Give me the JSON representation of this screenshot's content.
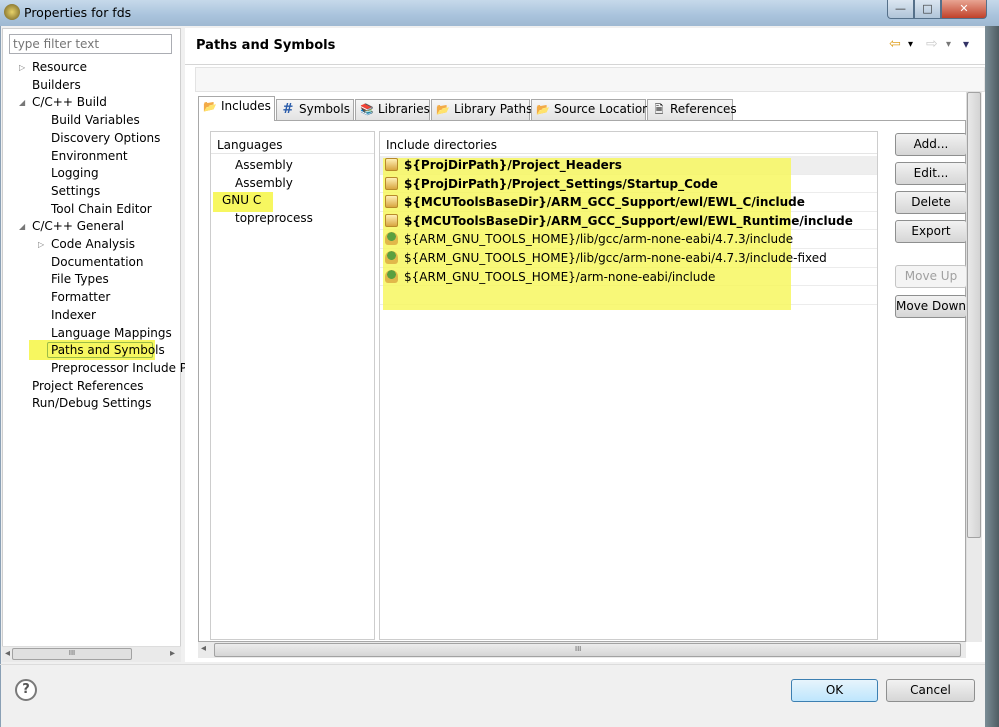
{
  "window": {
    "title": "Properties for fds",
    "minimize": "—",
    "maximize": "□",
    "close": "✕"
  },
  "filter": {
    "placeholder": "type filter text"
  },
  "tree": [
    {
      "label": "Resource",
      "level": 0,
      "twisty": "▷"
    },
    {
      "label": "Builders",
      "level": 0
    },
    {
      "label": "C/C++ Build",
      "level": 0,
      "twisty": "◢"
    },
    {
      "label": "Build Variables",
      "level": 1
    },
    {
      "label": "Discovery Options",
      "level": 1
    },
    {
      "label": "Environment",
      "level": 1
    },
    {
      "label": "Logging",
      "level": 1
    },
    {
      "label": "Settings",
      "level": 1
    },
    {
      "label": "Tool Chain Editor",
      "level": 1
    },
    {
      "label": "C/C++ General",
      "level": 0,
      "twisty": "◢"
    },
    {
      "label": "Code Analysis",
      "level": 1,
      "twisty": "▷"
    },
    {
      "label": "Documentation",
      "level": 1
    },
    {
      "label": "File Types",
      "level": 1
    },
    {
      "label": "Formatter",
      "level": 1
    },
    {
      "label": "Indexer",
      "level": 1
    },
    {
      "label": "Language Mappings",
      "level": 1
    },
    {
      "label": "Paths and Symbols",
      "level": 1,
      "selected": true
    },
    {
      "label": "Preprocessor Include Pa",
      "level": 1
    },
    {
      "label": "Project References",
      "level": 0
    },
    {
      "label": "Run/Debug Settings",
      "level": 0
    }
  ],
  "page": {
    "title": "Paths and Symbols"
  },
  "nav": {
    "back": "⇦",
    "back_menu": "▾",
    "forward": "⇨",
    "forward_menu": "▾",
    "view_menu": "▾"
  },
  "tabs": [
    {
      "label": "Includes",
      "icon": "📂",
      "active": true
    },
    {
      "label": "Symbols",
      "icon": "#"
    },
    {
      "label": "Libraries",
      "icon": "📚"
    },
    {
      "label": "Library Paths",
      "icon": "📂"
    },
    {
      "label": "Source Location",
      "icon": "📂"
    },
    {
      "label": "References",
      "icon": "🗎"
    }
  ],
  "languages": {
    "header": "Languages",
    "items": [
      "Assembly",
      "Assembly",
      "GNU C",
      "topreprocess"
    ],
    "selected": "GNU C"
  },
  "includes": {
    "header": "Include directories",
    "items": [
      {
        "path": "${ProjDirPath}/Project_Headers",
        "type": "workspace"
      },
      {
        "path": "${ProjDirPath}/Project_Settings/Startup_Code",
        "type": "workspace"
      },
      {
        "path": "${MCUToolsBaseDir}/ARM_GCC_Support/ewl/EWL_C/include",
        "type": "workspace"
      },
      {
        "path": "${MCUToolsBaseDir}/ARM_GCC_Support/ewl/EWL_Runtime/include",
        "type": "workspace"
      },
      {
        "path": "${ARM_GNU_TOOLS_HOME}/lib/gcc/arm-none-eabi/4.7.3/include",
        "type": "system"
      },
      {
        "path": "${ARM_GNU_TOOLS_HOME}/lib/gcc/arm-none-eabi/4.7.3/include-fixed",
        "type": "system"
      },
      {
        "path": "${ARM_GNU_TOOLS_HOME}/arm-none-eabi/include",
        "type": "system"
      }
    ]
  },
  "buttons": {
    "add": "Add...",
    "edit": "Edit...",
    "delete": "Delete",
    "export": "Export",
    "move_up": "Move Up",
    "move_down": "Move Down"
  },
  "scroll": {
    "h_grip": "III",
    "left": "◂",
    "right": "▸"
  },
  "footer": {
    "help": "?",
    "ok": "OK",
    "cancel": "Cancel"
  },
  "colors": {
    "highlight": "#f7f760"
  }
}
